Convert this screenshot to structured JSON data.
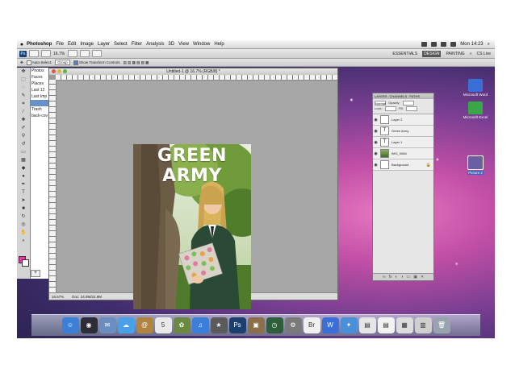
{
  "menubar": {
    "app_name": "Photoshop",
    "items": [
      "File",
      "Edit",
      "Image",
      "Layer",
      "Select",
      "Filter",
      "Analysis",
      "3D",
      "View",
      "Window",
      "Help"
    ],
    "clock": "Mon 14:23"
  },
  "appbar": {
    "ps_label": "Ps",
    "zoom": "16.7%",
    "workspaces": [
      "ESSENTIALS",
      "DESIGN",
      "PAINTING"
    ],
    "selected_workspace": "DESIGN",
    "cs_live": "CS Live"
  },
  "options": {
    "auto_select_label": "Auto-Select:",
    "auto_select_value": "Group",
    "show_transform_label": "Show Transform Controls"
  },
  "bridge": {
    "items": [
      "Photos",
      "Faces",
      "Places",
      "Last 12",
      "Last Imp",
      "Trash",
      "back-cov"
    ]
  },
  "document": {
    "title": "Untitled-1 @ 16.7% (RGB/8) *",
    "zoom": "16.67%",
    "doc_size": "Doc: 24.9M/24.9M",
    "photo_title": "GREEN ARMY"
  },
  "layers_panel": {
    "tabs": [
      "LAYERS",
      "CHANNELS",
      "PATHS"
    ],
    "mode": "Normal",
    "opacity_label": "Opacity:",
    "fill_label": "Fill:",
    "lock_label": "Lock:",
    "layers": [
      {
        "name": "Layer 2",
        "type": "blank"
      },
      {
        "name": "Green Army",
        "type": "text"
      },
      {
        "name": "Layer 1",
        "type": "text"
      },
      {
        "name": "IMG_0066",
        "type": "image"
      },
      {
        "name": "Background",
        "type": "blank"
      }
    ]
  },
  "desktop": {
    "icons": [
      {
        "label": "Microsoft Word",
        "color": "#3a6fd8"
      },
      {
        "label": "Microsoft Excel",
        "color": "#3aa648"
      },
      {
        "label": "Picture 2",
        "color": "#6a5fa0"
      }
    ]
  },
  "dock": {
    "apps": [
      {
        "name": "finder-icon",
        "glyph": "☺",
        "color": "#3c7fd8"
      },
      {
        "name": "dashboard-icon",
        "glyph": "◉",
        "color": "#2d2d3a"
      },
      {
        "name": "mail-icon",
        "glyph": "✉",
        "color": "#6a8ec0"
      },
      {
        "name": "ichat-icon",
        "glyph": "☁",
        "color": "#4aa0e8"
      },
      {
        "name": "address-book-icon",
        "glyph": "@",
        "color": "#b08440"
      },
      {
        "name": "ical-icon",
        "glyph": "5",
        "color": "#e9e9e9"
      },
      {
        "name": "iphoto-icon",
        "glyph": "✿",
        "color": "#6b8a3f"
      },
      {
        "name": "itunes-icon",
        "glyph": "♫",
        "color": "#3c7fd8"
      },
      {
        "name": "imovie-icon",
        "glyph": "★",
        "color": "#5a5a5a"
      },
      {
        "name": "photoshop-icon",
        "glyph": "Ps",
        "color": "#1c3f6e"
      },
      {
        "name": "preview-icon",
        "glyph": "▣",
        "color": "#8a6f4a"
      },
      {
        "name": "time-machine-icon",
        "glyph": "◷",
        "color": "#2e5e3a"
      },
      {
        "name": "system-preferences-icon",
        "glyph": "⚙",
        "color": "#7a7a7a"
      },
      {
        "name": "bridge-icon",
        "glyph": "Br",
        "color": "#f0f0f0"
      },
      {
        "name": "word-icon",
        "glyph": "W",
        "color": "#3a6fd8"
      },
      {
        "name": "safari-icon",
        "glyph": "✦",
        "color": "#4a90d8"
      },
      {
        "name": "document-icon",
        "glyph": "▤",
        "color": "#e6e6e6"
      },
      {
        "name": "document-icon-2",
        "glyph": "▤",
        "color": "#f2f2f2"
      },
      {
        "name": "downloads-icon",
        "glyph": "▦",
        "color": "#dcdcdc"
      },
      {
        "name": "stack-icon",
        "glyph": "▥",
        "color": "#cfcfcf"
      },
      {
        "name": "trash-icon",
        "glyph": "🗑",
        "color": "#9aa4b0"
      }
    ]
  },
  "colors": {
    "foreground": "#e53aa6",
    "background": "#ffffff"
  }
}
